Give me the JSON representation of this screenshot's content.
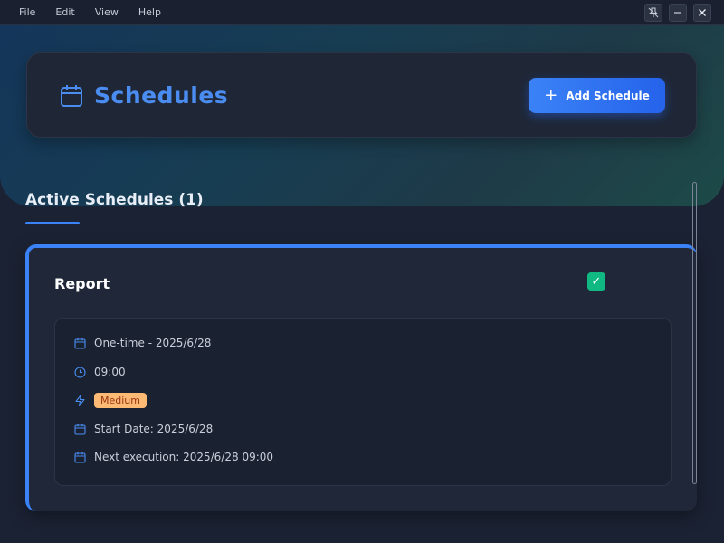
{
  "menu": [
    "File",
    "Edit",
    "View",
    "Help"
  ],
  "header": {
    "title": "Schedules",
    "add_button": "Add Schedule"
  },
  "section": {
    "title": "Active Schedules (1)"
  },
  "schedule": {
    "name": "Report",
    "enabled": true,
    "checkmark": "✓",
    "frequency": "One-time - 2025/6/28",
    "time": "09:00",
    "priority": "Medium",
    "start_date": "Start Date: 2025/6/28",
    "next_execution": "Next execution: 2025/6/28 09:00"
  },
  "colors": {
    "accent": "#3b82f6",
    "priority_bg": "#fdba74",
    "enabled": "#10b981"
  }
}
